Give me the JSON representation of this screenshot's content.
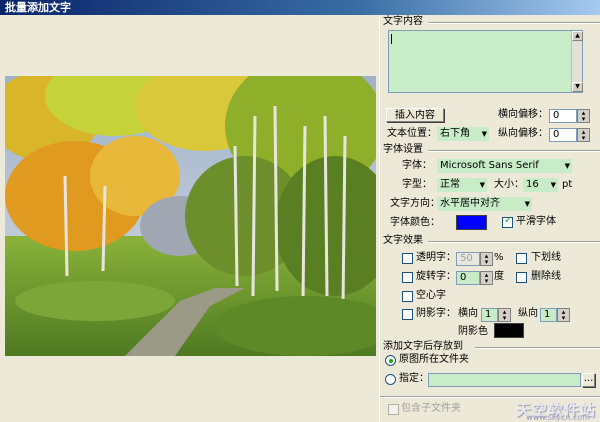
{
  "window": {
    "title": "批量添加文字"
  },
  "text_content": {
    "group_label": "文字内容",
    "text_value": "",
    "insert_button": "插入内容",
    "h_offset_label": "横向偏移：",
    "h_offset_value": "0",
    "position_label": "文本位置：",
    "position_value": "右下角",
    "v_offset_label": "纵向偏移：",
    "v_offset_value": "0"
  },
  "font_settings": {
    "group_label": "字体设置",
    "font_label": "字体：",
    "font_value": "Microsoft Sans Serif",
    "style_label": "字型：",
    "style_value": "正常",
    "size_label": "大小：",
    "size_value": "16",
    "size_unit": "pt",
    "direction_label": "文字方向：",
    "direction_value": "水平居中对齐",
    "color_label": "字体颜色：",
    "font_color": "#0000FF",
    "smooth_label": "平滑字体",
    "smooth_checked": true
  },
  "text_effects": {
    "group_label": "文字效果",
    "opacity_label": "透明字：",
    "opacity_value": "50",
    "opacity_unit": "%",
    "rotate_label": "旋转字：",
    "rotate_value": "0",
    "rotate_unit": "度",
    "hollow_label": "空心字",
    "shadow_label": "阴影字：",
    "shadow_h_label": "横向",
    "shadow_h_value": "1",
    "shadow_v_label": "纵向",
    "shadow_v_value": "1",
    "shadow_color_label": "阴影色",
    "shadow_color": "#000000",
    "underline_label": "下划线",
    "strikethrough_label": "删除线"
  },
  "save_location": {
    "group_label": "添加文字后存放到",
    "original_folder_label": "原图所在文件夹",
    "original_selected": true,
    "specify_label": "指定：",
    "specify_value": "",
    "browse_label": "...",
    "include_subfolders_label": "包含子文件夹"
  },
  "footer": {
    "watermark": "天空软件站",
    "watermark_url": "www.skycn.com"
  },
  "colors": {
    "field_bg": "#C8EBC8",
    "panel_bg": "#ECE9D8",
    "title_start": "#0A246A"
  }
}
